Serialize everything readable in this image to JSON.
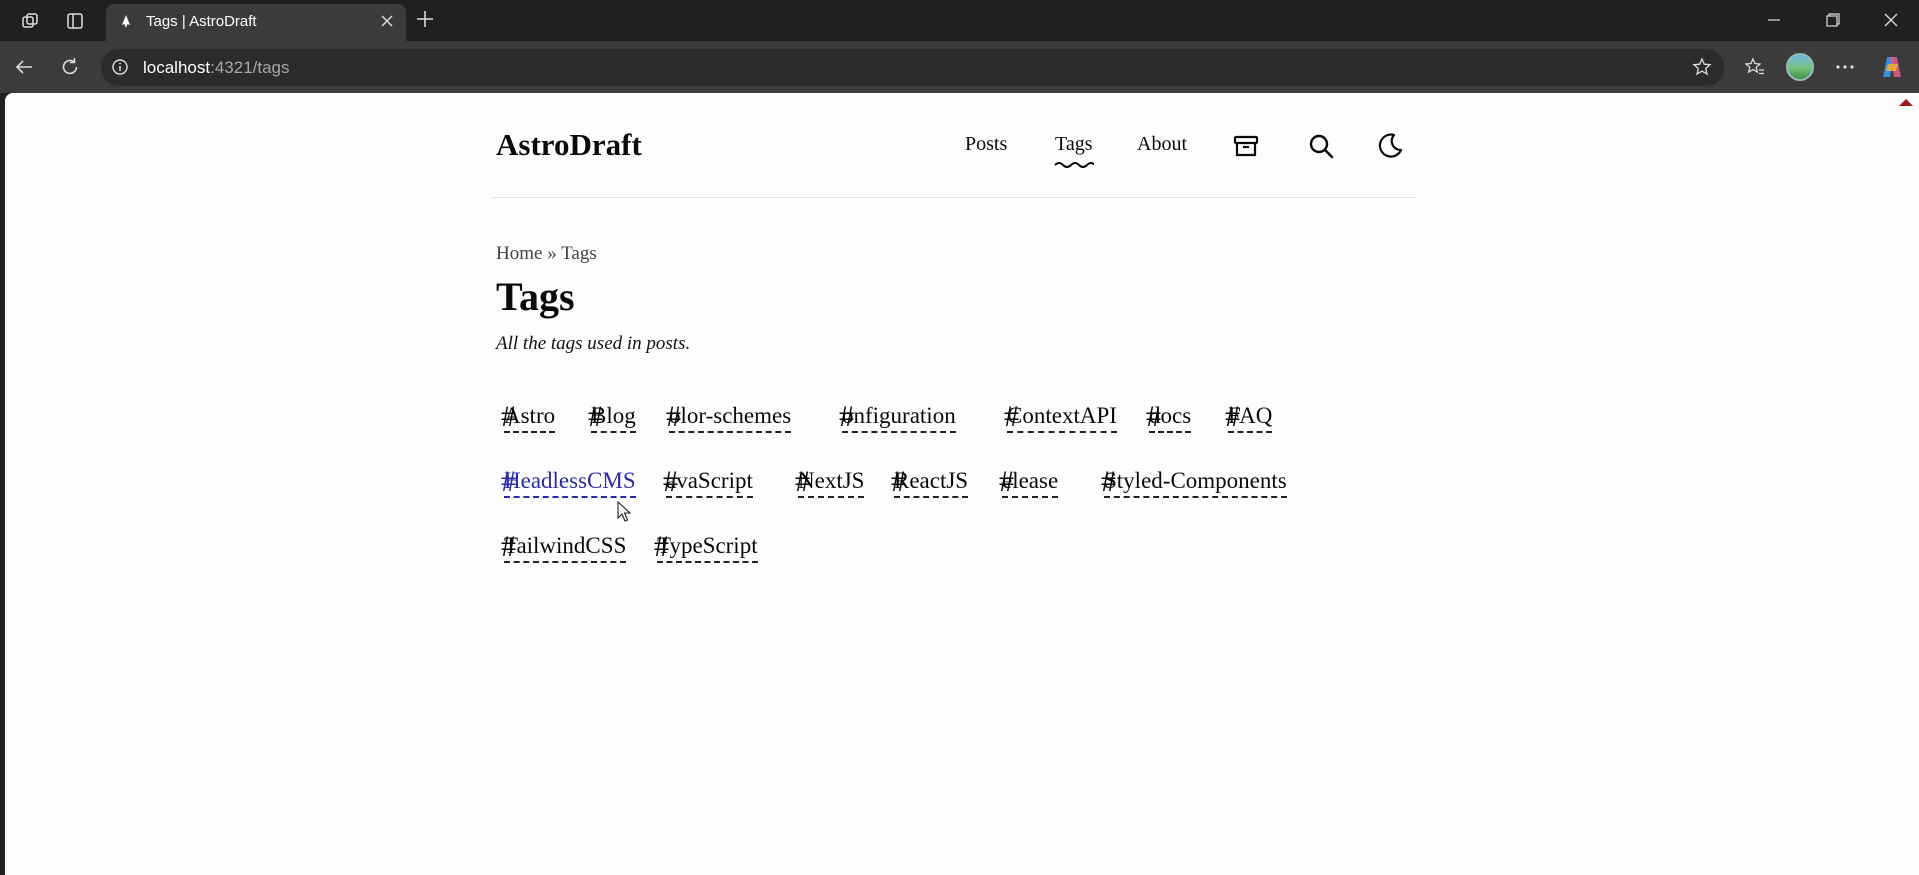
{
  "browser": {
    "tab_title": "Tags | AstroDraft",
    "url_host": "localhost",
    "url_path": ":4321/tags"
  },
  "site": {
    "logo": "AstroDraft",
    "nav": {
      "posts": "Posts",
      "tags": "Tags",
      "about": "About"
    },
    "breadcrumb": {
      "home": "Home",
      "separator": "»",
      "current": "Tags"
    },
    "title": "Tags",
    "description": "All the tags used in posts.",
    "tags": [
      "Astro",
      "Blog",
      "color-schemes",
      "configuration",
      "ContextAPI",
      "docs",
      "FAQ",
      "HeadlessCMS",
      "JavaScript",
      "NextJS",
      "ReactJS",
      "release",
      "Styled-Components",
      "TailwindCSS",
      "TypeScript"
    ],
    "tag_display": [
      "Astro",
      "Blog",
      "olor-schemes",
      "onfiguration",
      "ContextAPI",
      "docs",
      "FAQ",
      "HeadlessCMS",
      "avaScript",
      "NextJS",
      "ReactJS",
      "elease",
      "Styled-Components",
      "TailwindCSS",
      "TypeScript"
    ],
    "hovered_tag": "HeadlessCMS",
    "colors": {
      "text": "#0a0a0a",
      "link_hover": "#2b2ba8",
      "background": "#fdfdfd"
    }
  }
}
